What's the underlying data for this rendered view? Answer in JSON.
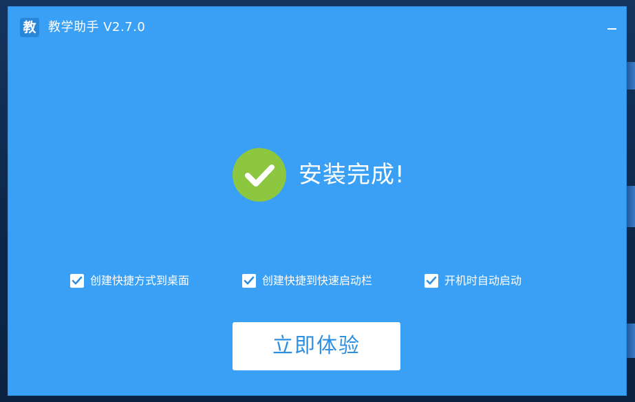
{
  "window": {
    "logo_char": "教",
    "title": "教学助手 V2.7.0",
    "minimize_icon": "minimize-icon"
  },
  "status": {
    "icon": "check-circle-icon",
    "text": "安装完成!"
  },
  "options": [
    {
      "label": "创建快捷方式到桌面",
      "checked": true
    },
    {
      "label": "创建快捷到快速启动栏",
      "checked": true
    },
    {
      "label": "开机时自动启动",
      "checked": true
    }
  ],
  "action": {
    "start_label": "立即体验"
  },
  "colors": {
    "window_bg": "#3aa0f5",
    "success": "#8dc63f",
    "button_text": "#2e8fe0"
  }
}
